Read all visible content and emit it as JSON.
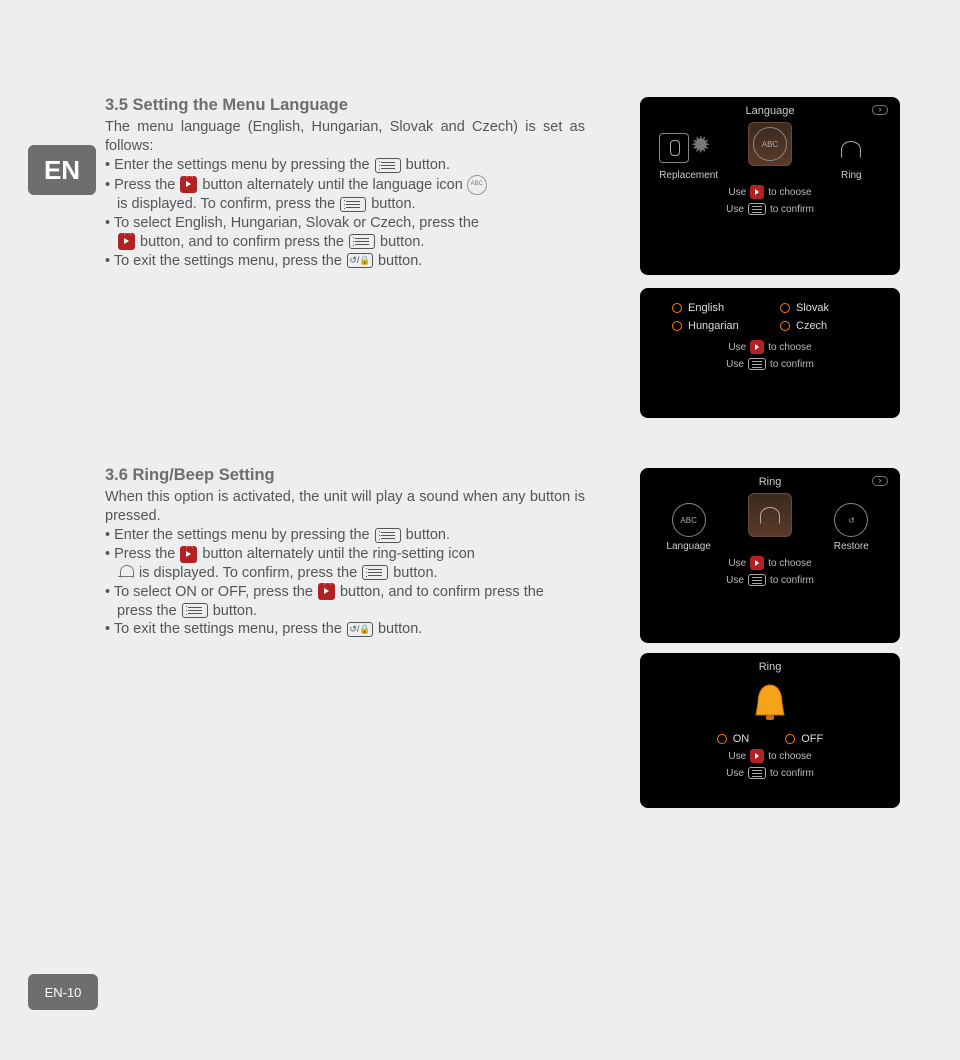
{
  "language_tab": "EN",
  "page_number": "EN-10",
  "section35": {
    "title": "3.5 Setting the Menu Language",
    "intro1": "The menu language (English, Hungarian, Slovak and Czech) is set as follows:",
    "b1_a": "Enter the settings menu by pressing the ",
    "b1_b": " button.",
    "b2_a": "Press the ",
    "b2_b": " button alternately until the language icon ",
    "b2_c": " is displayed. To confirm, press the ",
    "b2_d": " button.",
    "b3_a": "To select English, Hungarian, Slovak or Czech, press the ",
    "b3_b": " button, and to confirm press the ",
    "b3_c": " button.",
    "b4_a": "To exit the settings menu, press the ",
    "b4_b": " button."
  },
  "section36": {
    "title": "3.6 Ring/Beep Setting",
    "intro1": "When this option is activated, the unit will play a sound when any button is pressed.",
    "b1_a": "Enter the settings menu by pressing the ",
    "b1_b": " button.",
    "b2_a": "Press the ",
    "b2_b": " button alternately until the ring-setting icon ",
    "b2_c": " is displayed. To confirm, press the ",
    "b2_d": " button.",
    "b3_a": "To select ON or OFF, press the ",
    "b3_b": " button, and to confirm press the ",
    "b3_c": " button.",
    "b4_a": "To exit the settings menu, press the ",
    "b4_b": " button."
  },
  "device1": {
    "title": "Language",
    "items": {
      "left": "Replacement",
      "center": "ABC",
      "right": "Ring"
    },
    "hint1a": "Use",
    "hint1b": "to choose",
    "hint2a": "Use",
    "hint2b": "to confirm"
  },
  "device2": {
    "opts": {
      "a": "English",
      "b": "Slovak",
      "c": "Hungarian",
      "d": "Czech"
    },
    "hint1a": "Use",
    "hint1b": "to choose",
    "hint2a": "Use",
    "hint2b": "to confirm"
  },
  "device3": {
    "title": "Ring",
    "items": {
      "left": "Language",
      "center": "",
      "right": "Restore"
    },
    "leftIcon": "ABC",
    "hint1a": "Use",
    "hint1b": "to choose",
    "hint2a": "Use",
    "hint2b": "to confirm"
  },
  "device4": {
    "title": "Ring",
    "on": "ON",
    "off": "OFF",
    "hint1a": "Use",
    "hint1b": "to choose",
    "hint2a": "Use",
    "hint2b": "to confirm"
  },
  "abc_label": "ABC"
}
